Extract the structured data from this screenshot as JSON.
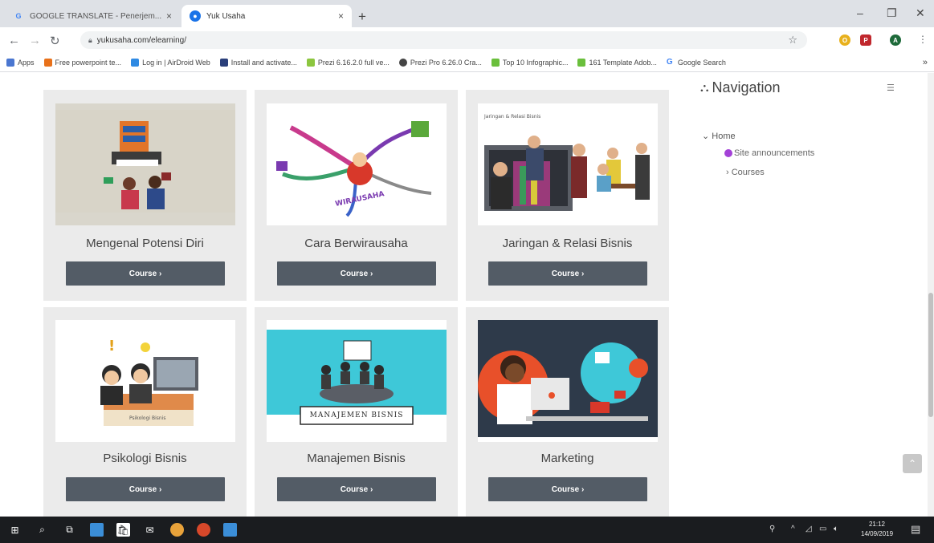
{
  "browser": {
    "tabs": [
      {
        "title": "GOOGLE TRANSLATE - Penerjem...",
        "active": false
      },
      {
        "title": "Yuk Usaha",
        "active": true
      }
    ],
    "url": "yukusaha.com/elearning/",
    "bookmarks": [
      "Apps",
      "Free powerpoint te...",
      "Log in | AirDroid Web",
      "Install and activate...",
      "Prezi 6.16.2.0 full ve...",
      "Prezi Pro 6.26.0 Cra...",
      "Top 10 Infographic...",
      "161 Template Adob...",
      "Google Search"
    ],
    "bookmarks_more": "»"
  },
  "courses": [
    {
      "title": "Mengenal Potensi Diri",
      "button": "Course ›",
      "image": "potensi-diri-illustration"
    },
    {
      "title": "Cara Berwirausaha",
      "button": "Course ›",
      "image": "wirausaha-mindmap-illustration"
    },
    {
      "title": "Jaringan & Relasi Bisnis",
      "button": "Course ›",
      "image": "business-network-illustration"
    },
    {
      "title": "Psikologi Bisnis",
      "button": "Course ›",
      "image": "psikologi-bisnis-illustration"
    },
    {
      "title": "Manajemen Bisnis",
      "button": "Course ›",
      "image": "manajemen-bisnis-illustration",
      "caption": "MANAJEMEN BISNIS"
    },
    {
      "title": "Marketing",
      "button": "Course ›",
      "image": "marketing-illustration"
    }
  ],
  "navigation": {
    "title": "Navigation",
    "home": "Home",
    "site_announcements": "Site announcements",
    "courses": "Courses"
  },
  "taskbar": {
    "time": "21:12",
    "date": "14/09/2019"
  },
  "colors": {
    "button": "#535c66",
    "card_bg": "#ebebeb",
    "announcement_dot": "#a341d7"
  }
}
